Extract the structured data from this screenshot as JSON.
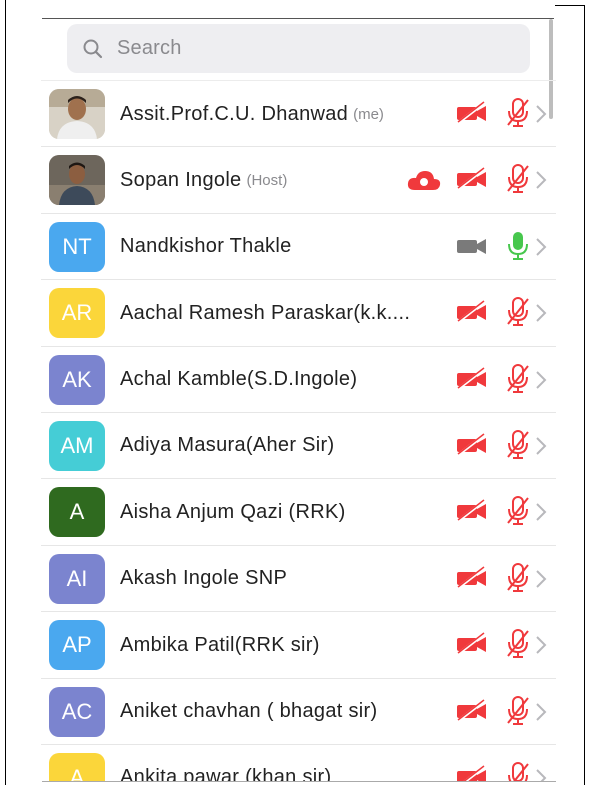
{
  "search": {
    "placeholder": "Search"
  },
  "colors": {
    "muted_red": "#f0393c",
    "mic_on_green": "#47c74d",
    "video_on_gray": "#7a7a7a",
    "cloud_red": "#f0393c"
  },
  "participants": [
    {
      "name": "Assit.Prof.C.U. Dhanwad",
      "tag": "(me)",
      "avatar_type": "photo",
      "initials": "",
      "avatar_color": "#c9c4bb",
      "cloud_recording": false,
      "video": "off",
      "mic": "muted"
    },
    {
      "name": "Sopan Ingole",
      "tag": "(Host)",
      "avatar_type": "photo",
      "initials": "",
      "avatar_color": "#8a8378",
      "cloud_recording": true,
      "video": "off",
      "mic": "muted"
    },
    {
      "name": "Nandkishor Thakle",
      "tag": "",
      "avatar_type": "initials",
      "initials": "NT",
      "avatar_color": "#4aa8ef",
      "cloud_recording": false,
      "video": "on",
      "mic": "on"
    },
    {
      "name": "Aachal Ramesh Paraskar(k.k....",
      "tag": "",
      "avatar_type": "initials",
      "initials": "AR",
      "avatar_color": "#fbd63a",
      "cloud_recording": false,
      "video": "off",
      "mic": "muted"
    },
    {
      "name": "Achal Kamble(S.D.Ingole)",
      "tag": "",
      "avatar_type": "initials",
      "initials": "AK",
      "avatar_color": "#7b84cf",
      "cloud_recording": false,
      "video": "off",
      "mic": "muted"
    },
    {
      "name": "Adiya Masura(Aher Sir)",
      "tag": "",
      "avatar_type": "initials",
      "initials": "AM",
      "avatar_color": "#45cdd6",
      "cloud_recording": false,
      "video": "off",
      "mic": "muted"
    },
    {
      "name": "Aisha Anjum Qazi (RRK)",
      "tag": "",
      "avatar_type": "initials",
      "initials": "A",
      "avatar_color": "#2f6a1f",
      "cloud_recording": false,
      "video": "off",
      "mic": "muted"
    },
    {
      "name": "Akash Ingole SNP",
      "tag": "",
      "avatar_type": "initials",
      "initials": "AI",
      "avatar_color": "#7b84cf",
      "cloud_recording": false,
      "video": "off",
      "mic": "muted"
    },
    {
      "name": "Ambika Patil(RRK sir)",
      "tag": "",
      "avatar_type": "initials",
      "initials": "AP",
      "avatar_color": "#4aa8ef",
      "cloud_recording": false,
      "video": "off",
      "mic": "muted"
    },
    {
      "name": "Aniket chavhan ( bhagat sir)",
      "tag": "",
      "avatar_type": "initials",
      "initials": "AC",
      "avatar_color": "#7b84cf",
      "cloud_recording": false,
      "video": "off",
      "mic": "muted"
    },
    {
      "name": "Ankita  pawar (khan sir)",
      "tag": "",
      "avatar_type": "initials",
      "initials": "A",
      "avatar_color": "#fbd63a",
      "cloud_recording": false,
      "video": "off",
      "mic": "muted"
    }
  ]
}
